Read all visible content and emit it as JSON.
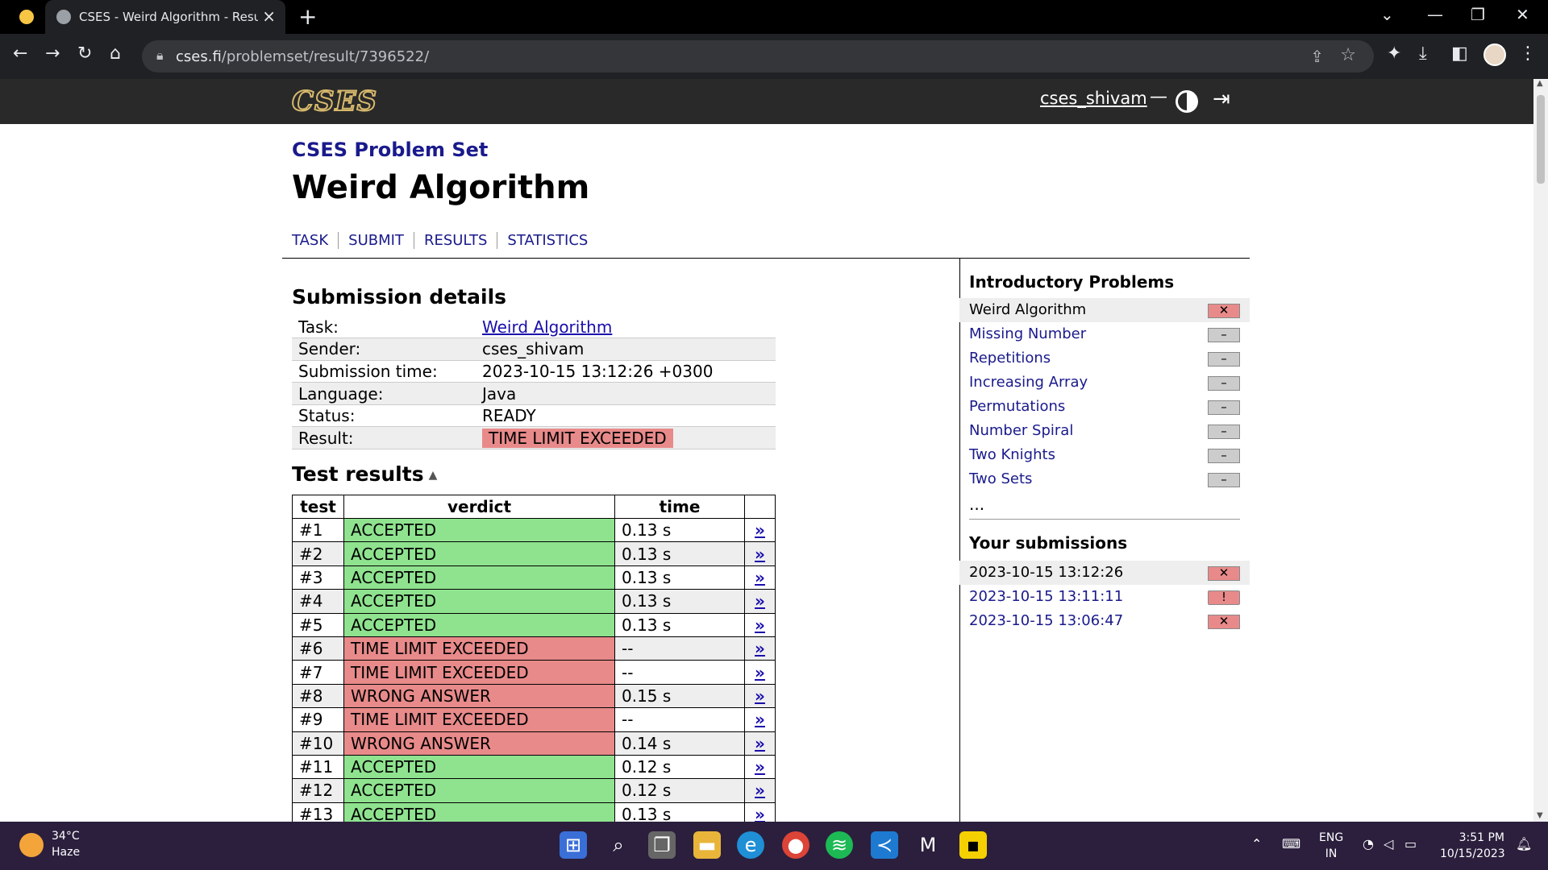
{
  "browser": {
    "tab_title": "CSES - Weird Algorithm - Result",
    "url_host": "cses.fi",
    "url_path": "/problemset/result/7396522/"
  },
  "site": {
    "logo": "CSES",
    "username": "cses_shivam",
    "dash": "—"
  },
  "page": {
    "problemset": "CSES Problem Set",
    "title": "Weird Algorithm",
    "nav": [
      "TASK",
      "SUBMIT",
      "RESULTS",
      "STATISTICS"
    ]
  },
  "submission": {
    "heading": "Submission details",
    "rows": [
      {
        "label": "Task:",
        "value": "Weird Algorithm"
      },
      {
        "label": "Sender:",
        "value": "cses_shivam"
      },
      {
        "label": "Submission time:",
        "value": "2023-10-15 13:12:26 +0300"
      },
      {
        "label": "Language:",
        "value": "Java"
      },
      {
        "label": "Status:",
        "value": "READY"
      },
      {
        "label": "Result:",
        "value": "TIME LIMIT EXCEEDED"
      }
    ]
  },
  "tests": {
    "heading": "Test results",
    "columns": [
      "test",
      "verdict",
      "time"
    ],
    "rows": [
      {
        "test": "#1",
        "verdict": "ACCEPTED",
        "time": "0.13 s",
        "ok": true
      },
      {
        "test": "#2",
        "verdict": "ACCEPTED",
        "time": "0.13 s",
        "ok": true
      },
      {
        "test": "#3",
        "verdict": "ACCEPTED",
        "time": "0.13 s",
        "ok": true
      },
      {
        "test": "#4",
        "verdict": "ACCEPTED",
        "time": "0.13 s",
        "ok": true
      },
      {
        "test": "#5",
        "verdict": "ACCEPTED",
        "time": "0.13 s",
        "ok": true
      },
      {
        "test": "#6",
        "verdict": "TIME LIMIT EXCEEDED",
        "time": "--",
        "ok": false
      },
      {
        "test": "#7",
        "verdict": "TIME LIMIT EXCEEDED",
        "time": "--",
        "ok": false
      },
      {
        "test": "#8",
        "verdict": "WRONG ANSWER",
        "time": "0.15 s",
        "ok": false
      },
      {
        "test": "#9",
        "verdict": "TIME LIMIT EXCEEDED",
        "time": "--",
        "ok": false
      },
      {
        "test": "#10",
        "verdict": "WRONG ANSWER",
        "time": "0.14 s",
        "ok": false
      },
      {
        "test": "#11",
        "verdict": "ACCEPTED",
        "time": "0.12 s",
        "ok": true
      },
      {
        "test": "#12",
        "verdict": "ACCEPTED",
        "time": "0.12 s",
        "ok": true
      },
      {
        "test": "#13",
        "verdict": "ACCEPTED",
        "time": "0.13 s",
        "ok": true
      }
    ],
    "link_glyph": "»"
  },
  "sidebar": {
    "heading": "Introductory Problems",
    "problems": [
      {
        "name": "Weird Algorithm",
        "status": "✕",
        "current": true,
        "failed": true
      },
      {
        "name": "Missing Number",
        "status": "–",
        "current": false,
        "failed": false
      },
      {
        "name": "Repetitions",
        "status": "–",
        "current": false,
        "failed": false
      },
      {
        "name": "Increasing Array",
        "status": "–",
        "current": false,
        "failed": false
      },
      {
        "name": "Permutations",
        "status": "–",
        "current": false,
        "failed": false
      },
      {
        "name": "Number Spiral",
        "status": "–",
        "current": false,
        "failed": false
      },
      {
        "name": "Two Knights",
        "status": "–",
        "current": false,
        "failed": false
      },
      {
        "name": "Two Sets",
        "status": "–",
        "current": false,
        "failed": false
      }
    ],
    "more": "...",
    "submissions_heading": "Your submissions",
    "submissions": [
      {
        "time": "2023-10-15 13:12:26",
        "status": "✕",
        "current": true,
        "kind": "x"
      },
      {
        "time": "2023-10-15 13:11:11",
        "status": "!",
        "current": false,
        "kind": "err"
      },
      {
        "time": "2023-10-15 13:06:47",
        "status": "✕",
        "current": false,
        "kind": "x"
      }
    ]
  },
  "taskbar": {
    "temp": "34°C",
    "condition": "Haze",
    "lang1": "ENG",
    "lang2": "IN",
    "time": "3:51 PM",
    "date": "10/15/2023"
  },
  "colors": {
    "accepted": "#8fe38f",
    "failed": "#e88a8a",
    "link": "#1a1a8c",
    "header_bg": "#292929"
  }
}
